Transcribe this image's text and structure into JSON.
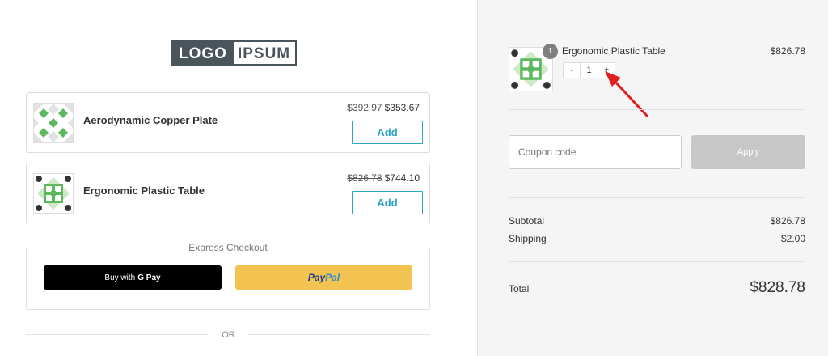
{
  "logo": {
    "part1": "LOGO",
    "part2": "IPSUM"
  },
  "products": [
    {
      "name": "Aerodynamic Copper Plate",
      "old_price": "$392.97",
      "price": "$353.67",
      "add_label": "Add"
    },
    {
      "name": "Ergonomic Plastic Table",
      "old_price": "$826.78",
      "price": "$744.10",
      "add_label": "Add"
    }
  ],
  "express": {
    "label": "Express Checkout",
    "gpay_label": "Buy with",
    "gpay_brand": "G Pay",
    "paypal_part1": "Pay",
    "paypal_part2": "Pal"
  },
  "or_label": "OR",
  "cart": {
    "item_name": "Ergonomic Plastic Table",
    "item_price": "$826.78",
    "quantity_badge": "1",
    "quantity": "1",
    "minus": "-",
    "plus": "+"
  },
  "coupon": {
    "placeholder": "Coupon code",
    "apply_label": "Apply"
  },
  "summary": {
    "subtotal_label": "Subtotal",
    "subtotal_value": "$826.78",
    "shipping_label": "Shipping",
    "shipping_value": "$2.00",
    "total_label": "Total",
    "total_value": "$828.78"
  },
  "colors": {
    "accent": "#2ea3c8",
    "paypal_yellow": "#f3c351",
    "annotation_arrow": "#e31e1e",
    "tile_green": "#5cb85c"
  },
  "icons": {
    "product_1": "green-diamond-tile-pattern",
    "product_2": "green-square-tile-pattern"
  }
}
